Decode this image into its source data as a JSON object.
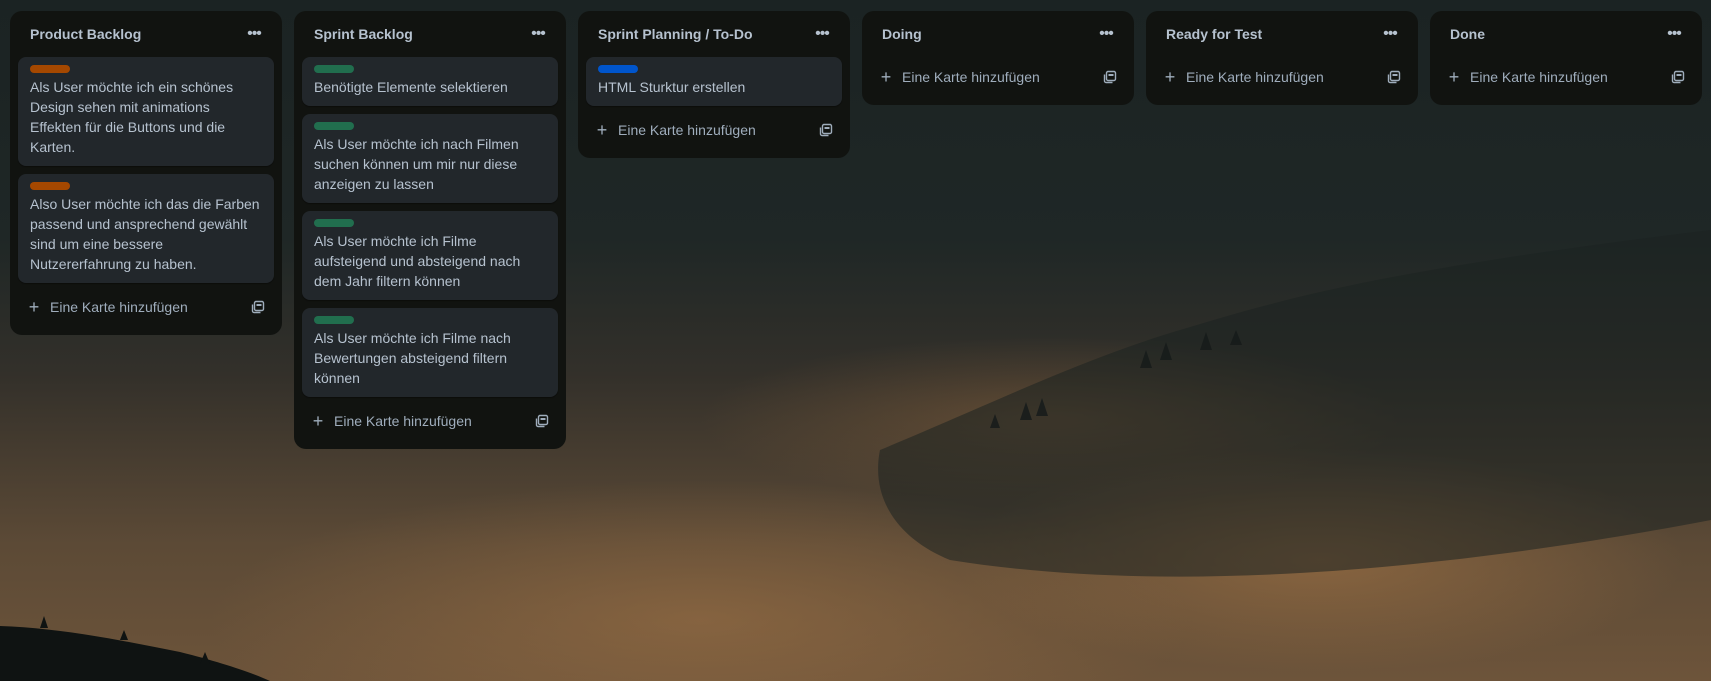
{
  "colors": {
    "list_bg": "#111310",
    "card_bg": "#22272b",
    "text": "#b6c2cf",
    "label_orange": "#a54800",
    "label_green": "#216e4e",
    "label_blue": "#0055cc"
  },
  "lists": [
    {
      "title": "Product Backlog",
      "menu_icon": "ellipsis-icon",
      "cards": [
        {
          "label_color": "#a54800",
          "text": "Als User möchte ich ein schönes Design sehen mit animations Effekten für die Buttons und die Karten."
        },
        {
          "label_color": "#a54800",
          "text": "Also User möchte ich das die Farben passend und ansprechend gewählt sind um eine bessere Nutzererfahrung zu haben."
        }
      ],
      "add_label": "Eine Karte hinzufügen"
    },
    {
      "title": "Sprint Backlog",
      "menu_icon": "ellipsis-icon",
      "cards": [
        {
          "label_color": "#216e4e",
          "text": "Benötigte Elemente selektieren"
        },
        {
          "label_color": "#216e4e",
          "text": "Als User möchte ich nach Filmen suchen können um mir nur diese anzeigen zu lassen"
        },
        {
          "label_color": "#216e4e",
          "text": "Als User möchte ich Filme aufsteigend und absteigend nach dem Jahr filtern können"
        },
        {
          "label_color": "#216e4e",
          "text": "Als User möchte ich Filme nach Bewertungen absteigend filtern können"
        }
      ],
      "add_label": "Eine Karte hinzufügen"
    },
    {
      "title": "Sprint Planning / To-Do",
      "menu_icon": "ellipsis-icon",
      "cards": [
        {
          "label_color": "#0055cc",
          "text": "HTML Sturktur erstellen"
        }
      ],
      "add_label": "Eine Karte hinzufügen"
    },
    {
      "title": "Doing",
      "menu_icon": "ellipsis-icon",
      "cards": [],
      "add_label": "Eine Karte hinzufügen"
    },
    {
      "title": "Ready for Test",
      "menu_icon": "ellipsis-icon",
      "cards": [],
      "add_label": "Eine Karte hinzufügen"
    },
    {
      "title": "Done",
      "menu_icon": "ellipsis-icon",
      "cards": [],
      "add_label": "Eine Karte hinzufügen"
    }
  ]
}
